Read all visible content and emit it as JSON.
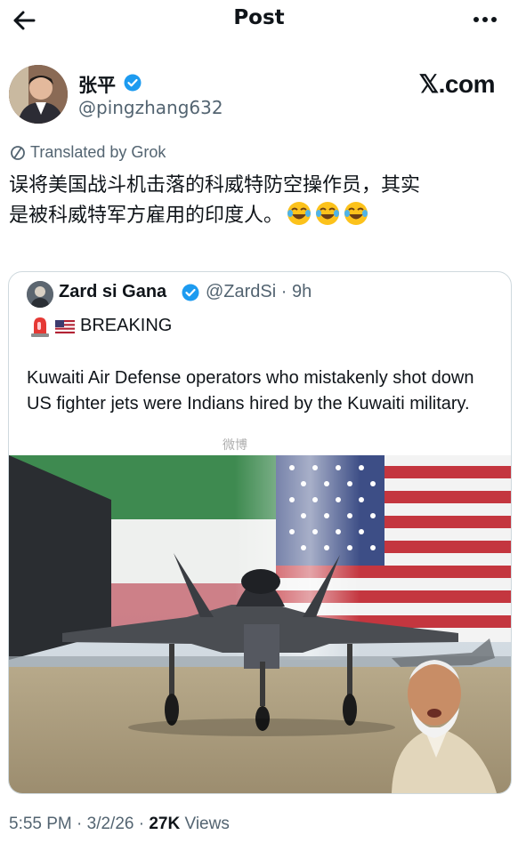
{
  "header": {
    "title": "Post"
  },
  "author": {
    "name": "张平",
    "handle": "@pingzhang632"
  },
  "brand": {
    "logo_text": "𝕏.com"
  },
  "translation": {
    "label": "Translated by Grok"
  },
  "post": {
    "text_line1": "误将美国战斗机击落的科威特防空操作员，其实",
    "text_line2": "是被科威特军方雇用的印度人。",
    "emojis": [
      "face-with-tears-of-joy",
      "face-with-tears-of-joy",
      "face-with-tears-of-joy"
    ]
  },
  "quote": {
    "name": "Zard si Gana",
    "handle_time": "@ZardSi · 9h",
    "breaking": "BREAKING",
    "text": "Kuwaiti Air Defense operators who mistakenly shot down US fighter jets were Indians hired by the Kuwaiti military.",
    "watermark": "微博"
  },
  "meta": {
    "time_date": "5:55 PM · 3/2/26 · ",
    "views_count": "27K",
    "views_label": " Views"
  },
  "colors": {
    "verified": "#1d9bf0",
    "muted": "#536471",
    "text": "#0f1419"
  }
}
